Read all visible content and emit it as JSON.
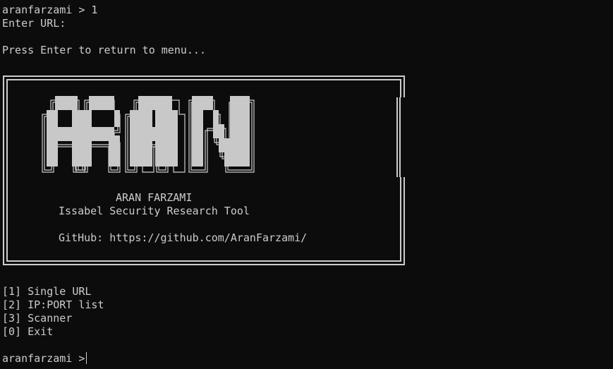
{
  "terminal": {
    "prompt_top": "aranfarzami > 1",
    "enter_url": "Enter URL:",
    "press_enter": "Press Enter to return to menu...",
    "prompt_bottom": "aranfarzami >"
  },
  "banner": {
    "logo_text": "ARAN",
    "name": "ARAN FARZAMI",
    "subtitle": "Issabel Security Research Tool",
    "github": "GitHub: https://github.com/AranFarzami/"
  },
  "menu": {
    "items": [
      {
        "label": "[1] Single URL"
      },
      {
        "label": "[2] IP:PORT list"
      },
      {
        "label": "[3] Scanner"
      },
      {
        "label": "[0] Exit"
      }
    ]
  },
  "colors": {
    "background": "#0c0c0c",
    "foreground": "#cccccc"
  }
}
